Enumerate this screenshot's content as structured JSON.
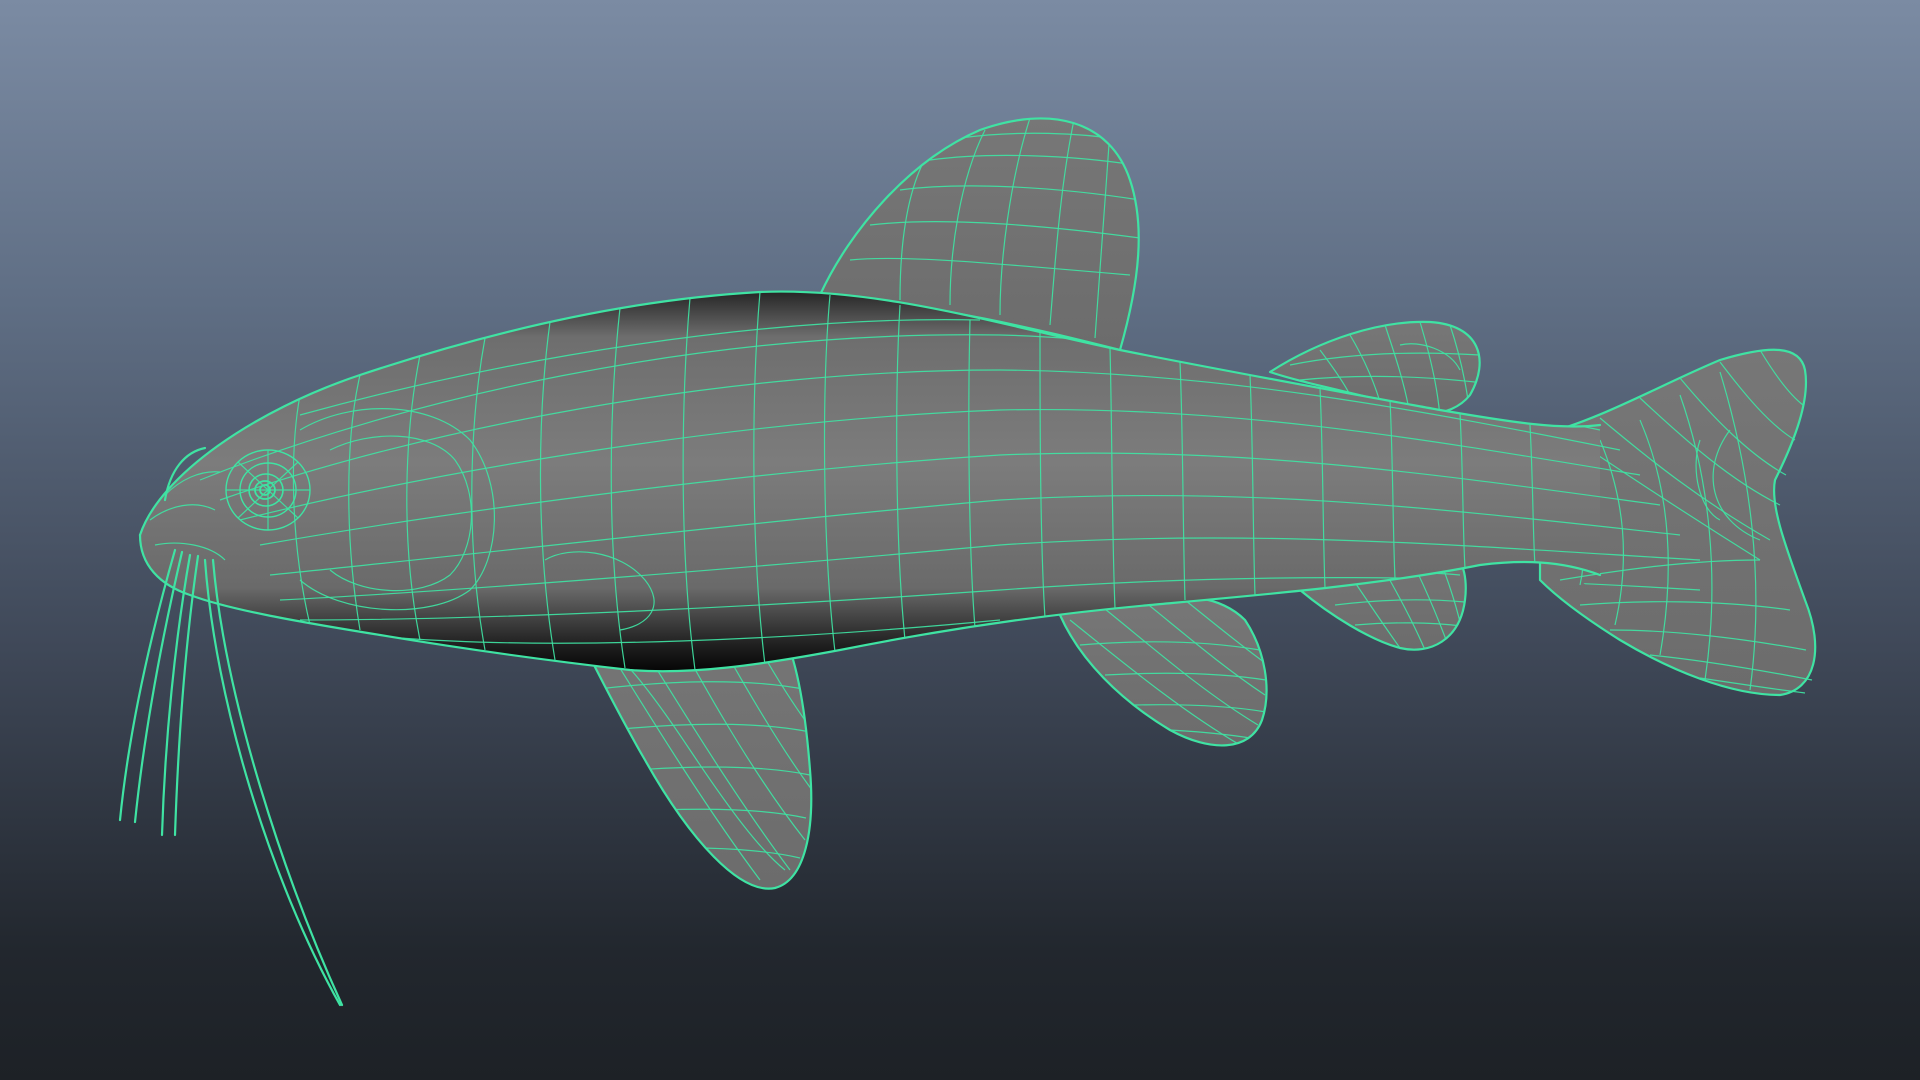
{
  "viewport": {
    "background_top": "#7b8ba3",
    "background_bottom": "#1d2126",
    "wireframe_color": "#3fe3a3",
    "surface_color": "#7a7a7a",
    "shadow_color": "#111111"
  },
  "model": {
    "subject": "catfish",
    "display_mode": "wireframe-on-shaded",
    "parts": [
      "body",
      "dorsal-fin",
      "adipose-fin",
      "caudal-fin",
      "pectoral-fin",
      "pelvic-fin",
      "anal-fin",
      "eye",
      "barbels"
    ]
  }
}
